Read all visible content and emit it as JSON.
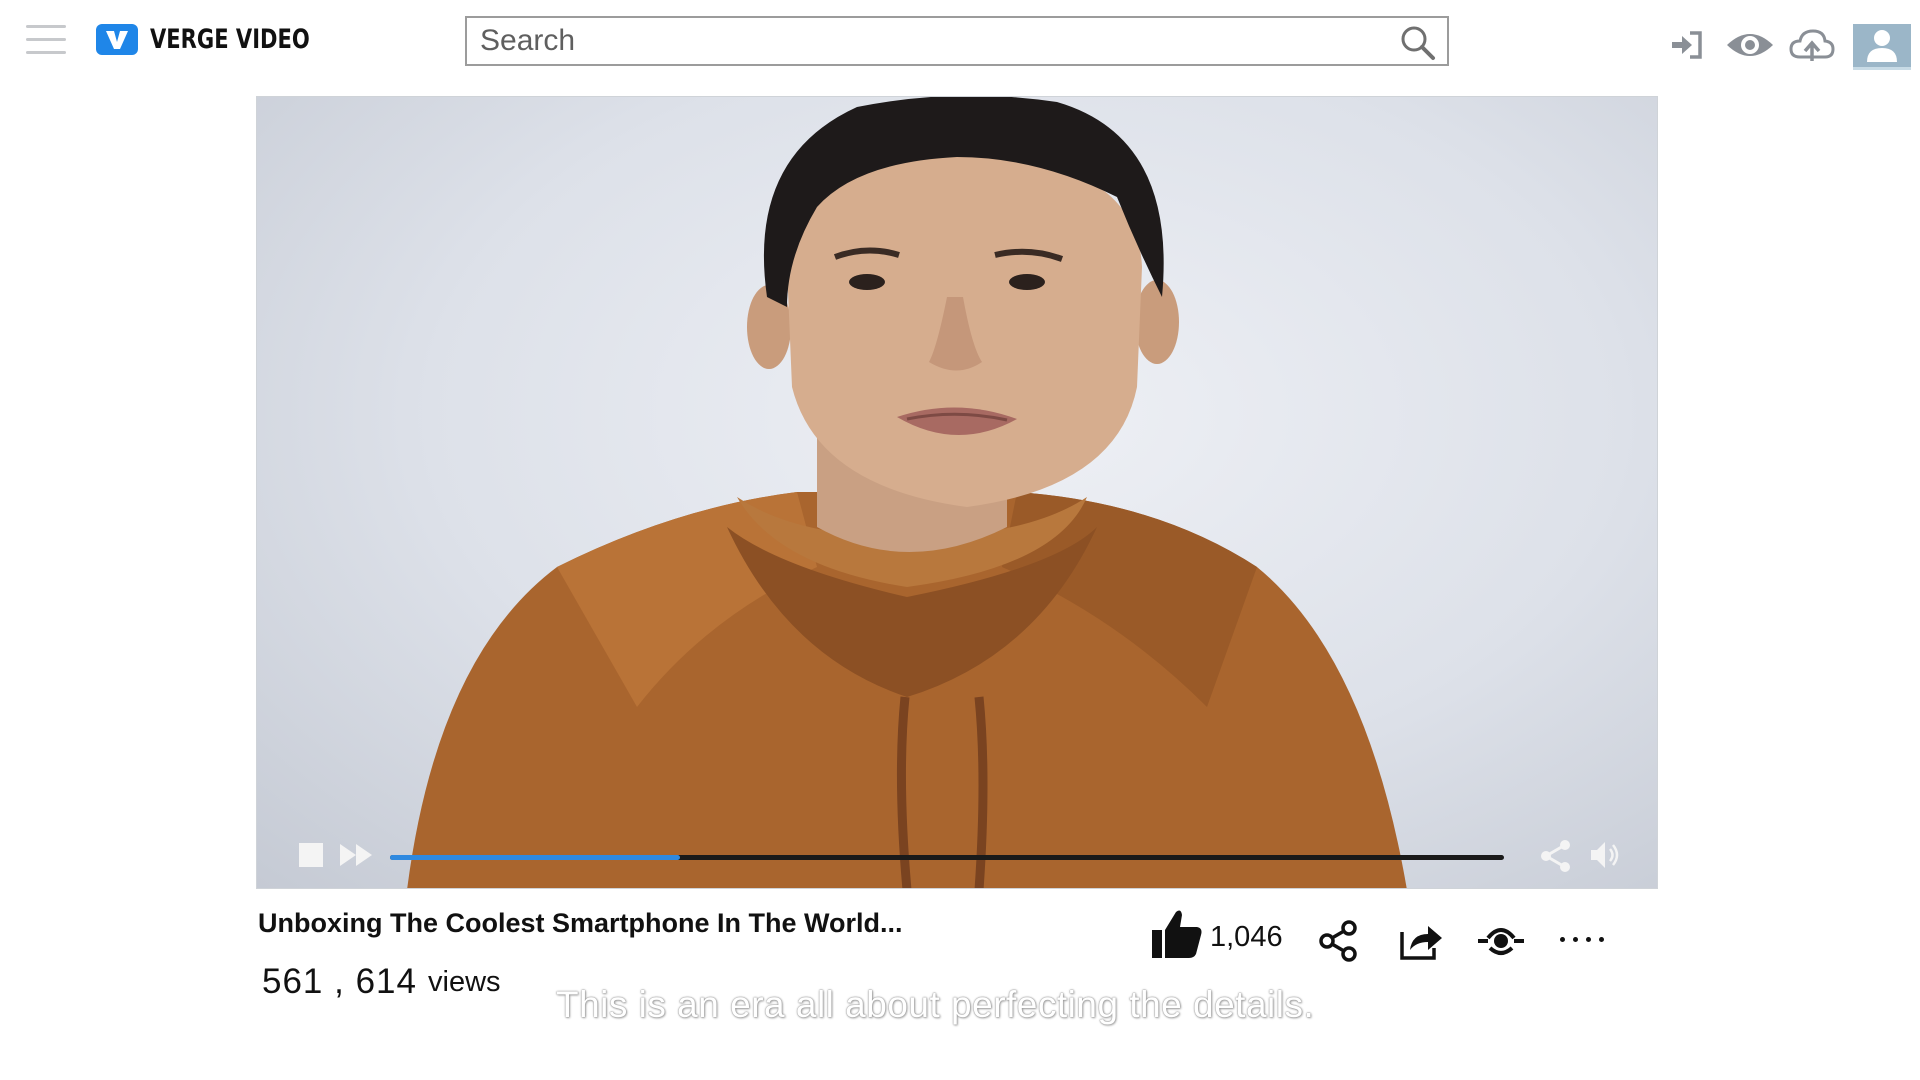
{
  "app": {
    "brand": "VERGE VIDEO",
    "brand_color": "#1f86e8"
  },
  "header": {
    "search_placeholder": "Search",
    "icons": [
      "menu-icon",
      "search-icon",
      "sign-in-icon",
      "eye-icon",
      "cloud-upload-icon",
      "user-avatar-icon"
    ]
  },
  "player": {
    "progress_fraction": 0.26,
    "progress_color": "#2f89e0",
    "controls": [
      "stop-icon",
      "fast-forward-icon",
      "share-icon",
      "volume-icon"
    ]
  },
  "video": {
    "title": "Unboxing The Coolest Smartphone In The World...",
    "views_count": "561 , 614",
    "views_label": "views",
    "likes": "1,046",
    "caption": "This is an era all about perfecting the details."
  },
  "actions": [
    "like-icon",
    "share-icon",
    "forward-share-icon",
    "playlist-icon",
    "more-icon"
  ]
}
